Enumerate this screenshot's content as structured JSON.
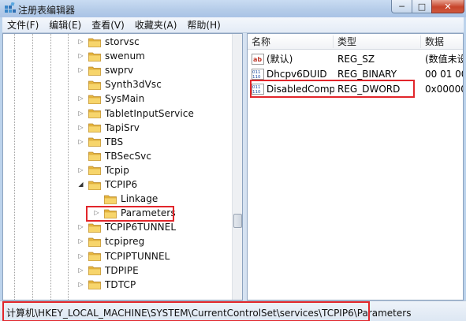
{
  "window": {
    "title": "注册表编辑器",
    "minimize": "─",
    "maximize": "□",
    "close": "✕"
  },
  "menu": [
    "文件(F)",
    "编辑(E)",
    "查看(V)",
    "收藏夹(A)",
    "帮助(H)"
  ],
  "tree": {
    "items": [
      {
        "label": "storvsc",
        "expander": "▷"
      },
      {
        "label": "swenum",
        "expander": "▷"
      },
      {
        "label": "swprv",
        "expander": "▷"
      },
      {
        "label": "Synth3dVsc",
        "expander": ""
      },
      {
        "label": "SysMain",
        "expander": "▷"
      },
      {
        "label": "TabletInputService",
        "expander": "▷"
      },
      {
        "label": "TapiSrv",
        "expander": "▷"
      },
      {
        "label": "TBS",
        "expander": "▷"
      },
      {
        "label": "TBSecSvc",
        "expander": ""
      },
      {
        "label": "Tcpip",
        "expander": "▷"
      },
      {
        "label": "TCPIP6",
        "expander": "◢"
      },
      {
        "label": "Linkage",
        "expander": ""
      },
      {
        "label": "Parameters",
        "expander": "▷"
      },
      {
        "label": "TCPIP6TUNNEL",
        "expander": "▷"
      },
      {
        "label": "tcpipreg",
        "expander": "▷"
      },
      {
        "label": "TCPIPTUNNEL",
        "expander": "▷"
      },
      {
        "label": "TDPIPE",
        "expander": "▷"
      },
      {
        "label": "TDTCP",
        "expander": "▷"
      }
    ],
    "selected": "Parameters"
  },
  "values": {
    "columns": [
      "名称",
      "类型",
      "数据"
    ],
    "rows": [
      {
        "name": "(默认)",
        "type": "REG_SZ",
        "data": "(数值未设",
        "icon": "string-value-icon"
      },
      {
        "name": "Dhcpv6DUID",
        "type": "REG_BINARY",
        "data": "00 01 00",
        "icon": "binary-value-icon"
      },
      {
        "name": "DisabledComp...",
        "type": "REG_DWORD",
        "data": "0x000000",
        "icon": "dword-value-icon"
      }
    ],
    "highlighted": "DisabledComponents"
  },
  "status": {
    "path": "计算机\\HKEY_LOCAL_MACHINE\\SYSTEM\\CurrentControlSet\\services\\TCPIP6\\Parameters"
  },
  "colors": {
    "highlight": "#e2262b",
    "folder": "#e8b73c",
    "titlebar": "#b4cbe8"
  }
}
